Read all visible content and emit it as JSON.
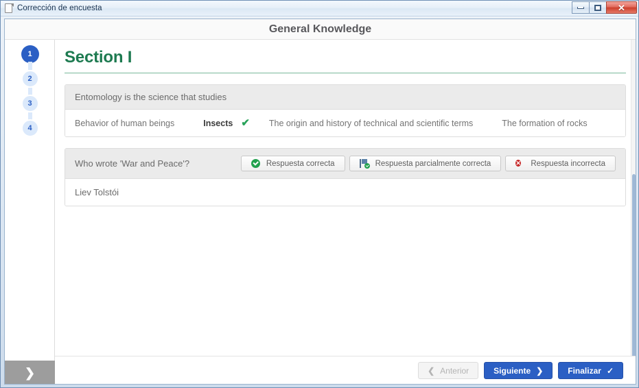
{
  "window": {
    "title": "Corrección de encuesta",
    "icon": "document-icon",
    "controls": {
      "minimize": "minimize-button",
      "maximize": "maximize-button",
      "close_glyph": "✕"
    }
  },
  "header": {
    "title": "General Knowledge"
  },
  "sidebar": {
    "steps": [
      {
        "number": "1",
        "state": "active"
      },
      {
        "number": "2",
        "state": "idle"
      },
      {
        "number": "3",
        "state": "idle"
      },
      {
        "number": "4",
        "state": "idle"
      }
    ],
    "toggle": {
      "name": "expand-sidebar-button",
      "glyph": "❯"
    }
  },
  "main": {
    "section_title": "Section I",
    "questions": [
      {
        "prompt": "Entomology is the science that studies",
        "type": "multiple-choice",
        "options": [
          {
            "label": "Behavior of human beings",
            "selected": false
          },
          {
            "label": "Insects",
            "selected": true,
            "mark": "✔"
          },
          {
            "label": "The origin and history of technical and scientific terms",
            "selected": false
          },
          {
            "label": "The formation of rocks",
            "selected": false
          }
        ]
      },
      {
        "prompt": "Who wrote 'War and Peace'?",
        "type": "open-answer",
        "answer": "Liev Tolstói",
        "grade_buttons": [
          {
            "label": "Respuesta correcta",
            "icon": "check-circle-icon"
          },
          {
            "label": "Respuesta parcialmente correcta",
            "icon": "flag-check-icon"
          },
          {
            "label": "Respuesta incorrecta",
            "icon": "x-circle-icon"
          }
        ]
      }
    ]
  },
  "footer": {
    "previous": {
      "label": "Anterior",
      "glyph": "❮",
      "disabled": true
    },
    "next": {
      "label": "Siguiente",
      "glyph": "❯"
    },
    "finish": {
      "label": "Finalizar",
      "glyph": "✓"
    }
  },
  "colors": {
    "accent_blue": "#2b5fc4",
    "section_green": "#1d7a50",
    "correct_green": "#22a14e",
    "incorrect_red": "#c62828"
  }
}
